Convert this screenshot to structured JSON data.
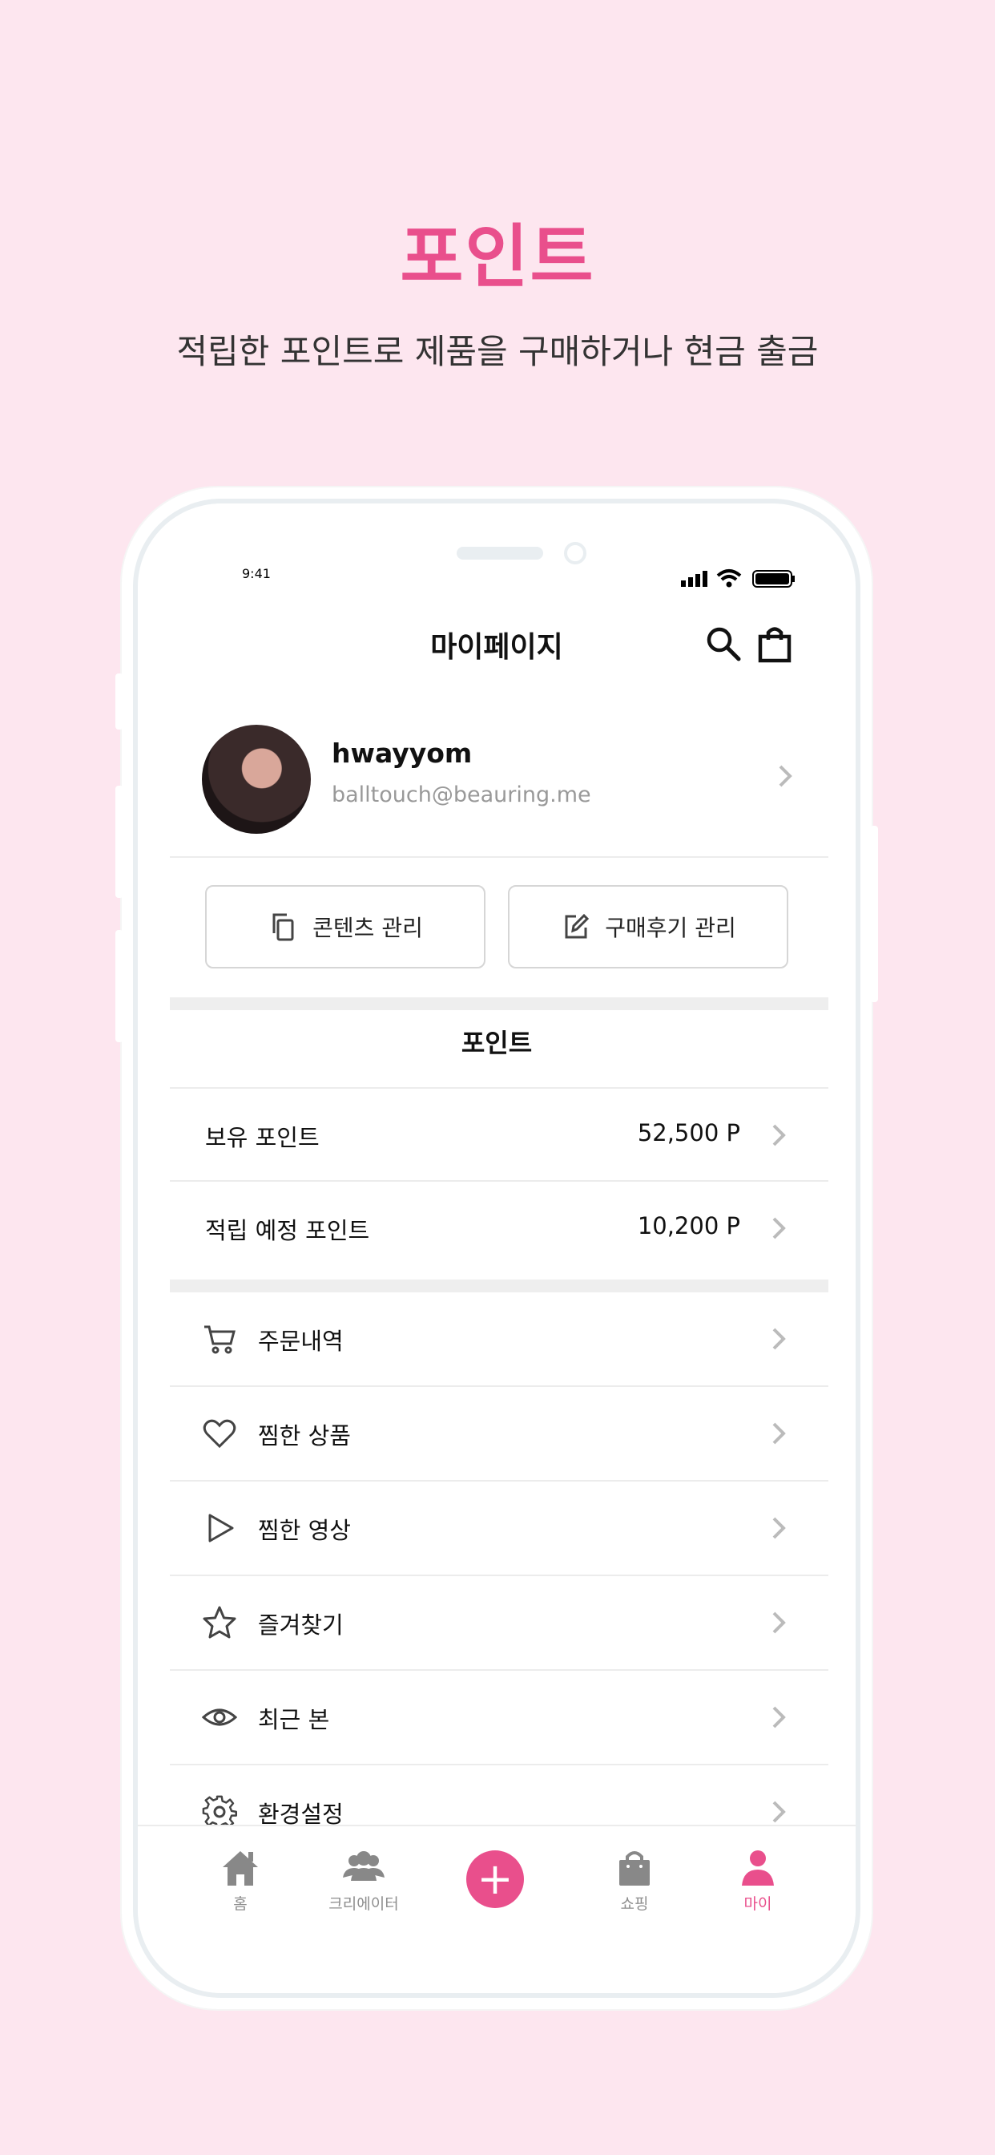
{
  "hero": {
    "title": "포인트",
    "subtitle": "적립한 포인트로 제품을 구매하거나 현금 출금"
  },
  "status_bar": {
    "time": "9:41"
  },
  "header": {
    "title": "마이페이지",
    "search_icon": "search-icon",
    "cart_icon": "shopping-bag-icon"
  },
  "profile": {
    "username": "hwayyom",
    "email": "balltouch@beauring.me"
  },
  "actions": {
    "content_manage": "콘텐츠 관리",
    "review_manage": "구매후기 관리"
  },
  "points": {
    "section_title": "포인트",
    "rows": [
      {
        "label": "보유 포인트",
        "value": "52,500 P"
      },
      {
        "label": "적립 예정 포인트",
        "value": "10,200 P"
      }
    ]
  },
  "menu": {
    "items": [
      {
        "label": "주문내역",
        "icon": "cart-icon"
      },
      {
        "label": "찜한 상품",
        "icon": "heart-icon"
      },
      {
        "label": "찜한 영상",
        "icon": "play-icon"
      },
      {
        "label": "즐겨찾기",
        "icon": "star-icon"
      },
      {
        "label": "최근 본",
        "icon": "eye-icon"
      },
      {
        "label": "환경설정",
        "icon": "gear-icon"
      }
    ]
  },
  "tabbar": {
    "items": [
      {
        "label": "홈",
        "icon": "home-icon"
      },
      {
        "label": "크리에이터",
        "icon": "creators-icon"
      },
      {
        "label": "+",
        "icon": "plus-icon"
      },
      {
        "label": "쇼핑",
        "icon": "shopping-bag-icon"
      },
      {
        "label": "마이",
        "icon": "person-icon"
      }
    ],
    "active_color": "#e94f8c"
  },
  "colors": {
    "accent": "#e94f8c",
    "background": "#fde6ef"
  }
}
